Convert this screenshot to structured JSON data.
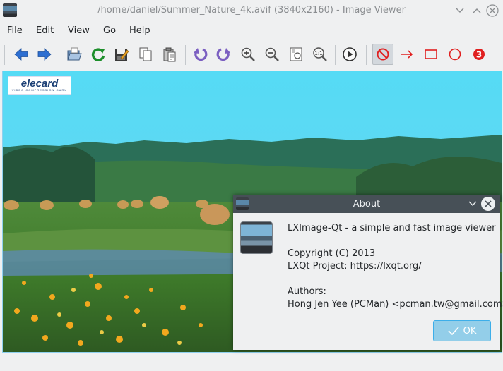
{
  "window": {
    "title": "/home/daniel/Summer_Nature_4k.avif (3840x2160) - Image Viewer",
    "icon": "image-viewer-icon",
    "controls": [
      "minimize",
      "maximize",
      "close"
    ]
  },
  "menubar": {
    "items": [
      "File",
      "Edit",
      "View",
      "Go",
      "Help"
    ]
  },
  "toolbar": {
    "buttons": [
      {
        "name": "previous",
        "icon": "arrow-left-icon"
      },
      {
        "name": "next",
        "icon": "arrow-right-icon"
      },
      {
        "name": "open",
        "icon": "folder-open-icon"
      },
      {
        "name": "reload",
        "icon": "reload-icon"
      },
      {
        "name": "save-as",
        "icon": "save-as-icon"
      },
      {
        "name": "copy",
        "icon": "copy-icon"
      },
      {
        "name": "paste",
        "icon": "paste-icon"
      },
      {
        "name": "rotate-counterclockwise",
        "icon": "rotate-ccw-icon"
      },
      {
        "name": "rotate-clockwise",
        "icon": "rotate-cw-icon"
      },
      {
        "name": "zoom-in",
        "icon": "zoom-in-icon"
      },
      {
        "name": "zoom-out",
        "icon": "zoom-out-icon"
      },
      {
        "name": "zoom-fit",
        "icon": "zoom-fit-icon"
      },
      {
        "name": "zoom-original",
        "icon": "zoom-original-icon",
        "text": "1:1"
      },
      {
        "name": "slideshow",
        "icon": "play-icon"
      },
      {
        "name": "annotation-none",
        "icon": "no-annotation-icon",
        "checked": true
      },
      {
        "name": "annotation-arrow",
        "icon": "arrow-annotation-icon"
      },
      {
        "name": "annotation-rectangle",
        "icon": "rectangle-annotation-icon"
      },
      {
        "name": "annotation-circle",
        "icon": "circle-annotation-icon"
      },
      {
        "name": "annotation-number",
        "icon": "number-annotation-icon",
        "text": "3"
      }
    ]
  },
  "image": {
    "logo_text": "elecard",
    "logo_subtext": "VIDEO COMPRESSION GURU"
  },
  "about_dialog": {
    "title": "About",
    "description": "LXImage-Qt - a simple and fast image viewer",
    "copyright": "Copyright (C) 2013",
    "project": "LXQt Project: https://lxqt.org/",
    "authors_label": "Authors:",
    "author": "Hong Jen Yee (PCMan) <pcman.tw@gmail.com>",
    "ok_label": "OK"
  },
  "colors": {
    "window_bg": "#eff0f1",
    "dialog_titlebar": "#475057",
    "accent": "#3daee9",
    "toolbar_arrow_blue": "#2e6fd1",
    "annotation_red": "#e02020"
  }
}
